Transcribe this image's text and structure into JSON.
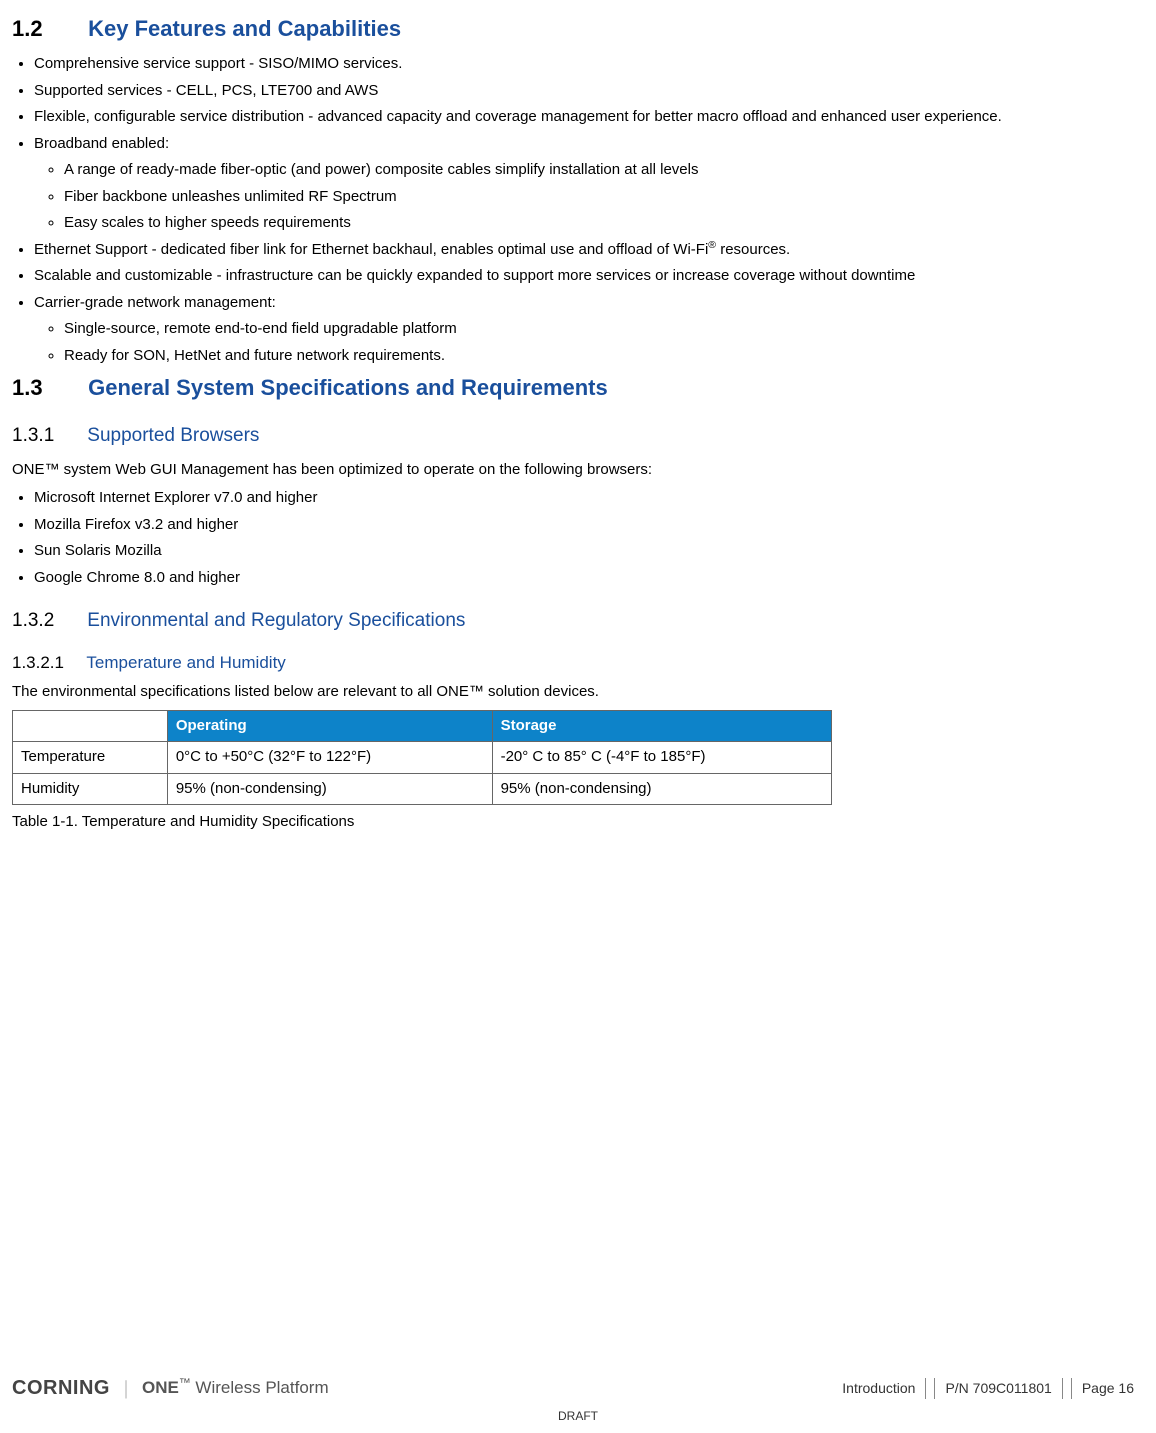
{
  "section12": {
    "num": "1.2",
    "title": "Key Features and Capabilities",
    "bullets": {
      "b1": "Comprehensive service support - SISO/MIMO services.",
      "b2": "Supported services - CELL, PCS, LTE700 and AWS",
      "b3": "Flexible, configurable service distribution - advanced capacity and coverage management for better macro offload and enhanced user experience.",
      "b4": "Broadband enabled:",
      "b4a": "A range of ready-made fiber-optic (and power) composite cables simplify installation at all levels",
      "b4b": "Fiber backbone unleashes unlimited RF Spectrum",
      "b4c": "Easy scales to higher speeds requirements",
      "b5a": "Ethernet Support - dedicated fiber link for Ethernet backhaul, enables optimal use and offload of Wi-Fi",
      "b5sup": "®",
      "b5b": " resources.",
      "b6": "Scalable and customizable - infrastructure can be quickly expanded to support more services or increase coverage without downtime",
      "b7": "Carrier-grade network management:",
      "b7a": "Single-source, remote end-to-end field upgradable platform",
      "b7b": "Ready for SON, HetNet and future network requirements."
    }
  },
  "section13": {
    "num": "1.3",
    "title": "General System Specifications and Requirements"
  },
  "section131": {
    "num": "1.3.1",
    "title": "Supported Browsers",
    "intro": "ONE™ system Web GUI Management has been optimized to operate on the following browsers:",
    "bullets": {
      "b1": "Microsoft Internet Explorer v7.0 and   higher",
      "b2": "Mozilla Firefox v3.2 and higher",
      "b3": "Sun Solaris Mozilla",
      "b4": "Google Chrome 8.0 and higher"
    }
  },
  "section132": {
    "num": "1.3.2",
    "title": "Environmental and Regulatory Specifications"
  },
  "section1321": {
    "num": "1.3.2.1",
    "title": "Temperature and Humidity",
    "intro": "The environmental specifications listed below are relevant to all ONE™ solution devices.",
    "table": {
      "h1": "",
      "h2": "Operating",
      "h3": "Storage",
      "r1c1": "Temperature",
      "r1c2": "0°C to +50°C (32°F to 122°F)",
      "r1c3": "-20° C to 85° C (-4°F to 185°F)",
      "r2c1": "Humidity",
      "r2c2": "95% (non-condensing)",
      "r2c3": "95% (non-condensing)"
    },
    "caption": "Table 1-1. Temperature and Humidity Specifications"
  },
  "footer": {
    "corning": "CORNING",
    "onewp_one": "ONE",
    "onewp_tm": "™",
    "onewp_rest": " Wireless Platform",
    "section": "Introduction",
    "pn": "P/N 709C011801",
    "page": "Page 16",
    "draft": "DRAFT"
  },
  "chart_data": {
    "type": "table",
    "title": "Temperature and Humidity Specifications",
    "columns": [
      "",
      "Operating",
      "Storage"
    ],
    "rows": [
      [
        "Temperature",
        "0°C to +50°C (32°F to 122°F)",
        "-20° C to 85° C (-4°F to 185°F)"
      ],
      [
        "Humidity",
        "95% (non-condensing)",
        "95% (non-condensing)"
      ]
    ]
  }
}
